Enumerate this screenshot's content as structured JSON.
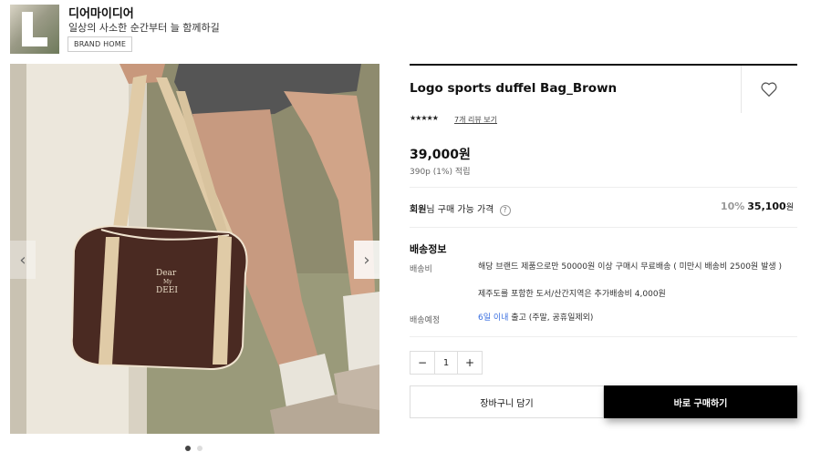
{
  "brand": {
    "logo_letter": "L",
    "name": "디어마이디어",
    "tagline": "일상의 사소한 순간부터 늘 함께하길",
    "home_label": "BRAND HOME"
  },
  "gallery": {
    "bag_print": "Dear My DEEI",
    "prev_icon": "chevron-left-icon",
    "next_icon": "chevron-right-icon",
    "slides": 2,
    "active_slide": 1
  },
  "product": {
    "title": "Logo sports duffel Bag_Brown",
    "stars": "★★★★★",
    "review_link": "7개 리뷰 보기",
    "price": "39,000원",
    "points": "390p (1%) 적립"
  },
  "member_price": {
    "label_strong": "회원",
    "label_rest": "님 구매 가능 가격",
    "help": "?",
    "discount": "10%",
    "amount": "35,100",
    "currency": "원"
  },
  "shipping": {
    "title": "배송정보",
    "fee_label": "배송비",
    "fee_text": "해당 브랜드 제품으로만 50000원 이상 구매시 무료배송 ( 미만시 배송비 2500원 발생 )",
    "extra_text": "제주도를 포함한 도서/산간지역은 추가배송비 4,000원",
    "eta_label": "배송예정",
    "eta_days": "6일 이내",
    "eta_rest": " 출고 (주말, 공휴일제외)"
  },
  "quantity": {
    "minus": "−",
    "value": "1",
    "plus": "+"
  },
  "actions": {
    "cart": "장바구니 담기",
    "buy": "바로 구매하기"
  },
  "colors": {
    "accent_blue": "#3a6fe0",
    "buy_button": "#000000",
    "bag": "#4a2a22"
  }
}
